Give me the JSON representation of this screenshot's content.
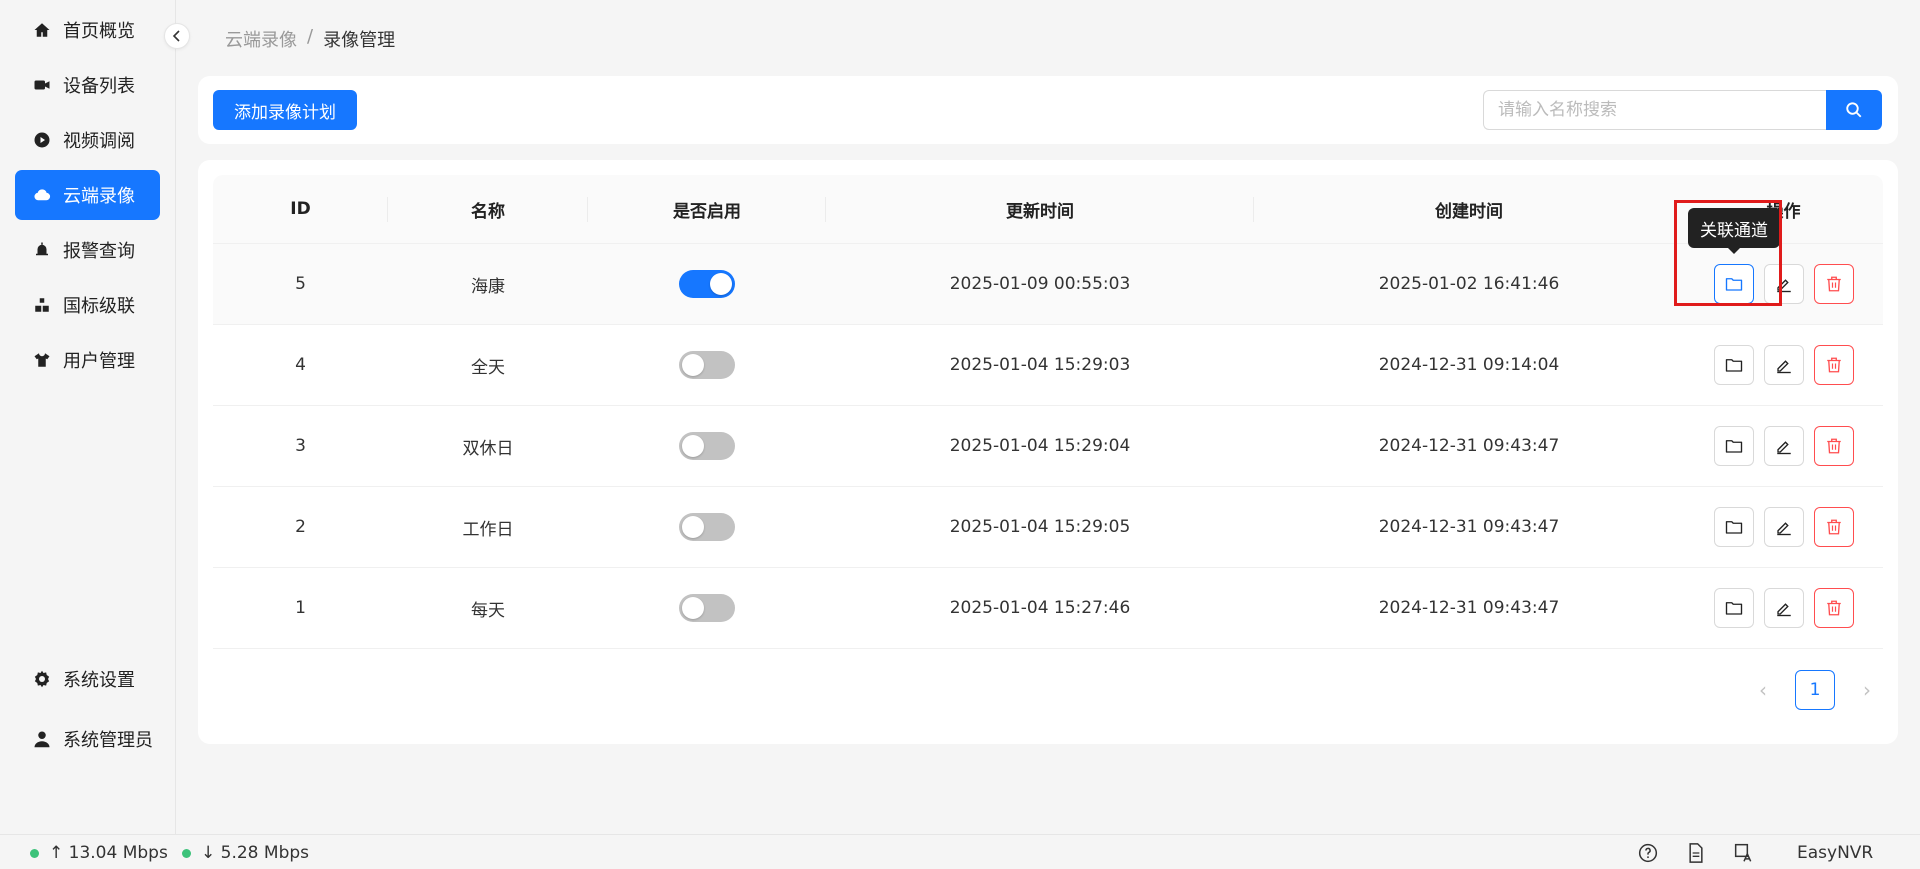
{
  "sidebar": {
    "items": [
      {
        "label": "首页概览",
        "icon": "home-icon"
      },
      {
        "label": "设备列表",
        "icon": "camera-icon"
      },
      {
        "label": "视频调阅",
        "icon": "play-icon"
      },
      {
        "label": "云端录像",
        "icon": "cloud-icon",
        "active": true
      },
      {
        "label": "报警查询",
        "icon": "alarm-icon"
      },
      {
        "label": "国标级联",
        "icon": "cascade-icon"
      },
      {
        "label": "用户管理",
        "icon": "shirt-icon"
      }
    ],
    "bottom_items": [
      {
        "label": "系统设置",
        "icon": "gear-icon"
      },
      {
        "label": "系统管理员",
        "icon": "user-icon"
      }
    ]
  },
  "breadcrumb": {
    "parent": "云端录像",
    "separator": "/",
    "current": "录像管理"
  },
  "toolbar": {
    "add_label": "添加录像计划",
    "search_placeholder": "请输入名称搜索",
    "search_value": ""
  },
  "table": {
    "headers": {
      "id": "ID",
      "name": "名称",
      "enabled": "是否启用",
      "updated": "更新时间",
      "created": "创建时间",
      "actions": "操作"
    },
    "rows": [
      {
        "id": "5",
        "name": "海康",
        "enabled": true,
        "updated": "2025-01-09 00:55:03",
        "created": "2025-01-02 16:41:46"
      },
      {
        "id": "4",
        "name": "全天",
        "enabled": false,
        "updated": "2025-01-04 15:29:03",
        "created": "2024-12-31 09:14:04"
      },
      {
        "id": "3",
        "name": "双休日",
        "enabled": false,
        "updated": "2025-01-04 15:29:04",
        "created": "2024-12-31 09:43:47"
      },
      {
        "id": "2",
        "name": "工作日",
        "enabled": false,
        "updated": "2025-01-04 15:29:05",
        "created": "2024-12-31 09:43:47"
      },
      {
        "id": "1",
        "name": "每天",
        "enabled": false,
        "updated": "2025-01-04 15:27:46",
        "created": "2024-12-31 09:43:47"
      }
    ]
  },
  "tooltip": {
    "text": "关联通道"
  },
  "pagination": {
    "current": "1",
    "prev": "‹",
    "next": "›"
  },
  "statusbar": {
    "upload": "↑ 13.04 Mbps",
    "download": "↓ 5.28 Mbps",
    "brand": "EasyNVR",
    "status_color": "#3cc27a"
  },
  "colors": {
    "accent": "#1677ff",
    "danger": "#ff4d4f",
    "highlight": "#e01b1b"
  }
}
